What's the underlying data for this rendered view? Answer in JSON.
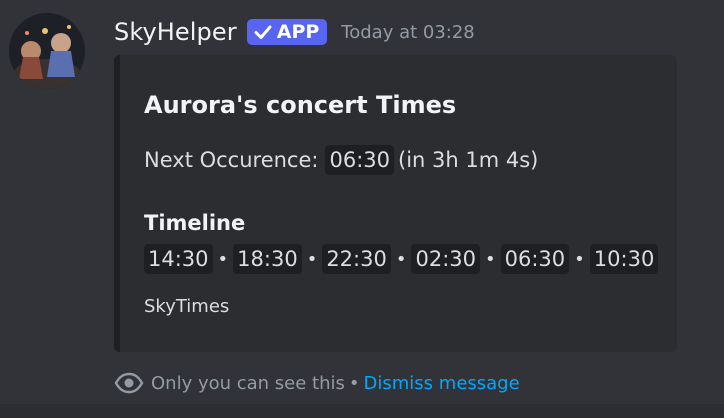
{
  "message": {
    "author": "SkyHelper",
    "badge": "APP",
    "timestamp": "Today at 03:28"
  },
  "embed": {
    "title": "Aurora's concert Times",
    "next_label": "Next Occurence:",
    "next_time": "06:30",
    "next_relative": "(in 3h 1m 4s)",
    "timeline_heading": "Timeline",
    "timeline": [
      "14:30",
      "18:30",
      "22:30",
      "02:30",
      "06:30",
      "10:30"
    ],
    "separator": "•",
    "footer": "SkyTimes"
  },
  "ephemeral": {
    "icon": "eye-icon",
    "text": "Only you can see this",
    "separator": "•",
    "dismiss_label": "Dismiss message"
  },
  "colors": {
    "background": "#313338",
    "embed_background": "#2b2d31",
    "badge": "#5865f2",
    "link": "#00a8fc"
  }
}
